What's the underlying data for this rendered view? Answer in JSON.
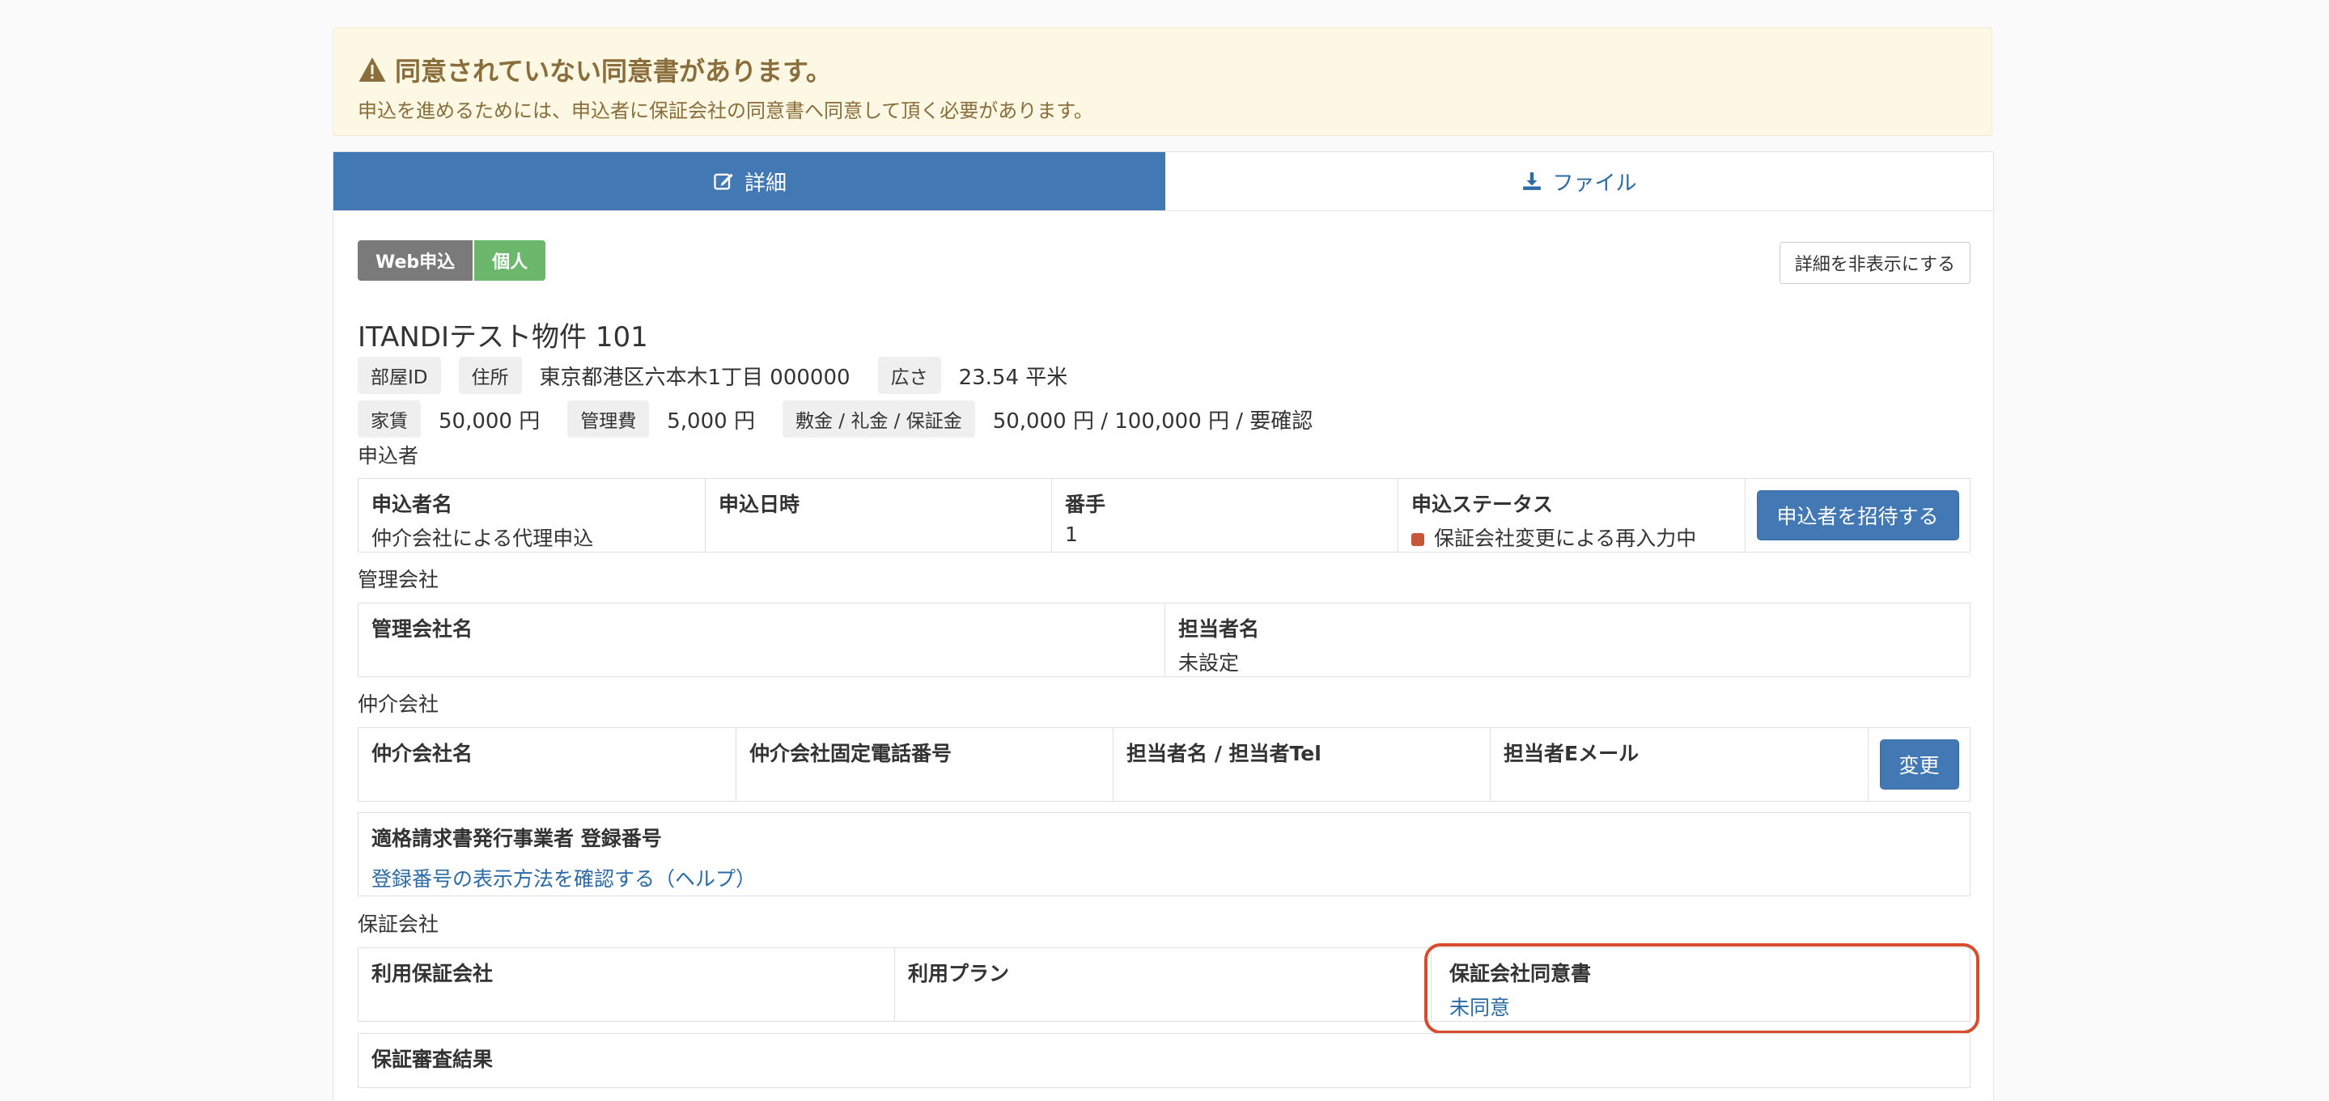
{
  "alert": {
    "title": "同意されていない同意書があります。",
    "body": "申込を進めるためには、申込者に保証会社の同意書へ同意して頂く必要があります。"
  },
  "tabs": [
    {
      "label": "詳細",
      "icon": "edit-icon"
    },
    {
      "label": "ファイル",
      "icon": "download-icon"
    }
  ],
  "badges": {
    "type": "Web申込",
    "category": "個人"
  },
  "hide_details_button": "詳細を非表示にする",
  "property": {
    "title": "ITANDIテスト物件 101",
    "room_id_label": "部屋ID",
    "address_label": "住所",
    "address": "東京都港区六本木1丁目 000000",
    "area_label": "広さ",
    "area": "23.54 平米",
    "rent_label": "家賃",
    "rent": "50,000 円",
    "fee_label": "管理費",
    "fee": "5,000 円",
    "deposit_label": "敷金 / 礼金 / 保証金",
    "deposit": "50,000 円 / 100,000 円 / 要確認"
  },
  "applicant": {
    "section": "申込者",
    "name_label": "申込者名",
    "name": "仲介会社による代理申込",
    "date_label": "申込日時",
    "date": "",
    "order_label": "番手",
    "order": "1",
    "status_label": "申込ステータス",
    "status": "保証会社変更による再入力中",
    "invite_button": "申込者を招待する"
  },
  "management": {
    "section": "管理会社",
    "company_label": "管理会社名",
    "company": "",
    "person_label": "担当者名",
    "person": "未設定"
  },
  "broker": {
    "section": "仲介会社",
    "company_label": "仲介会社名",
    "phone_label": "仲介会社固定電話番号",
    "person_label": "担当者名 / 担当者Tel",
    "email_label": "担当者Eメール",
    "change_button": "変更",
    "invoice_label": "適格請求書発行事業者 登録番号",
    "invoice_link": "登録番号の表示方法を確認する（ヘルプ）"
  },
  "guarantor": {
    "section": "保証会社",
    "company_label": "利用保証会社",
    "plan_label": "利用プラン",
    "consent_label": "保証会社同意書",
    "consent_value": "未同意",
    "result_label": "保証審査結果"
  }
}
